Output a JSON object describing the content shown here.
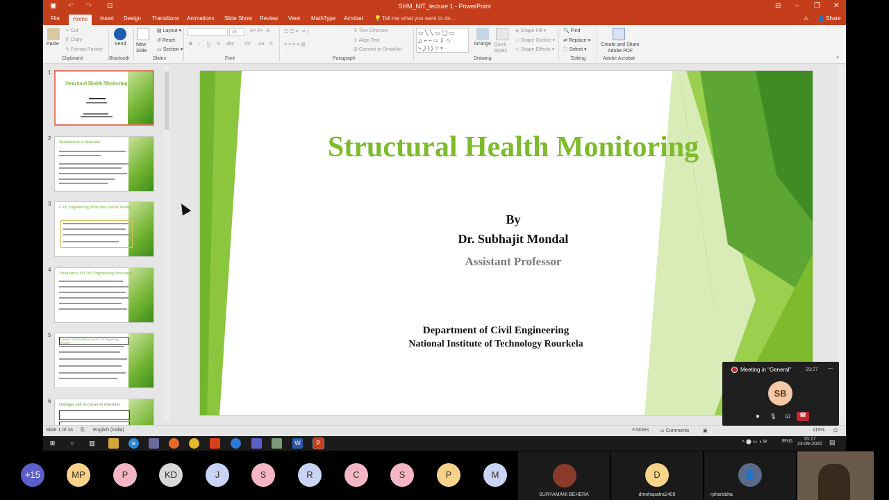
{
  "window": {
    "title": "SHM_NIT_lecture 1 - PowerPoint",
    "share": "Share"
  },
  "tabs": [
    "File",
    "Home",
    "Insert",
    "Design",
    "Transitions",
    "Animations",
    "Slide Show",
    "Review",
    "View",
    "MathType",
    "Acrobat"
  ],
  "tell_me": "Tell me what you want to do...",
  "ribbon": {
    "clipboard": {
      "paste": "Paste",
      "cut": "Cut",
      "copy": "Copy",
      "format_painter": "Format Painter",
      "label": "Clipboard"
    },
    "bluetooth": {
      "send": "Send",
      "label": "Bluetooth"
    },
    "slides": {
      "new_slide": "New Slide",
      "layout": "Layout",
      "reset": "Reset",
      "section": "Section",
      "label": "Slides"
    },
    "font": {
      "label": "Font",
      "size": "18"
    },
    "paragraph": {
      "text_direction": "Text Direction",
      "align_text": "Align Text",
      "convert_smartart": "Convert to SmartArt",
      "label": "Paragraph"
    },
    "drawing": {
      "arrange": "Arrange",
      "quick_styles": "Quick Styles",
      "shape_fill": "Shape Fill",
      "shape_outline": "Shape Outline",
      "shape_effects": "Shape Effects",
      "label": "Drawing"
    },
    "editing": {
      "find": "Find",
      "replace": "Replace",
      "select": "Select",
      "label": "Editing"
    },
    "acrobat": {
      "create_share": "Create and Share Adobe PDF",
      "label": "Adobe Acrobat"
    }
  },
  "thumbnails": [
    {
      "num": "1",
      "title": "Structural Health Monitoring"
    },
    {
      "num": "2",
      "title": "Introduction to Structure"
    },
    {
      "num": "3",
      "title": "Civil Engineering Structures and its ability"
    },
    {
      "num": "4",
      "title": "Uniqueness of Civil Engineering Structures"
    },
    {
      "num": "5",
      "title": "Examples of Health Monitoring in Civil Engineering Structure"
    },
    {
      "num": "6",
      "title": "Damages and its causes in structures"
    }
  ],
  "slide": {
    "title": "Structural Health  Monitoring",
    "by": "By",
    "name": "Dr. Subhajit Mondal",
    "role": "Assistant Professor",
    "dept1": "Department of Civil Engineering",
    "dept2": "National  Institute of Technology Rourkela"
  },
  "status": {
    "slide": "Slide 1 of 33",
    "language": "English (India)",
    "notes": "Notes",
    "comments": "Comments",
    "zoom": "115%"
  },
  "meeting": {
    "title": "Meeting in \"General\"",
    "time": "29:27",
    "initials": "SB"
  },
  "taskbar": {
    "lang": "ENG",
    "time": "15:17",
    "date": "23-09-2020"
  },
  "participants": [
    {
      "label": "+15",
      "color": "#5b5fc7"
    },
    {
      "label": "MP",
      "color": "#f6d28b"
    },
    {
      "label": "P",
      "color": "#f4b6c4"
    },
    {
      "label": "KD",
      "color": "#d8d8d8"
    },
    {
      "label": "J",
      "color": "#c9d4f4"
    },
    {
      "label": "S",
      "color": "#f4b6c4"
    },
    {
      "label": "R",
      "color": "#c9d4f4"
    },
    {
      "label": "C",
      "color": "#f4b6c4"
    },
    {
      "label": "S",
      "color": "#f4b6c4"
    },
    {
      "label": "P",
      "color": "#f6d28b"
    },
    {
      "label": "M",
      "color": "#c9d4f4"
    }
  ],
  "tiles": [
    {
      "name": "SURYAMANI BEHERA"
    },
    {
      "name": "dmohapatra1409",
      "initial": "D"
    },
    {
      "name": "rphardaha"
    }
  ]
}
